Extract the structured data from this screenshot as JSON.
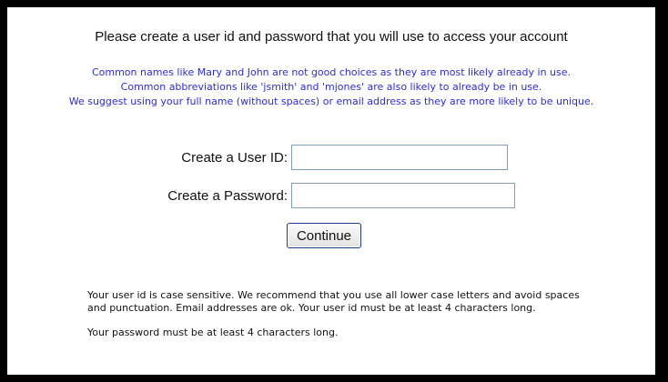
{
  "title": "Please create a user id and password that you will use to access your account",
  "notes": [
    "Common names like Mary and John are not good choices as they are most likely already in use.",
    "Common abbreviations like 'jsmith' and 'mjones' are also likely to already be in use.",
    "We suggest using your full name (without spaces) or email address as they are more likely to be unique."
  ],
  "form": {
    "user_id_label": "Create a User ID:",
    "user_id_value": "",
    "password_label": "Create a Password:",
    "password_value": "",
    "continue_label": "Continue"
  },
  "help": {
    "user_id_text": "Your user id is case sensitive. We recommend that you use all lower case letters and avoid spaces and punctuation. Email addresses are ok. Your user id must be at least 4 characters long.",
    "password_text": "Your password must be at least 4 characters long."
  },
  "colors": {
    "notes_text": "#2c2cd8",
    "frame": "#000000",
    "input_border": "#7f9db9"
  }
}
